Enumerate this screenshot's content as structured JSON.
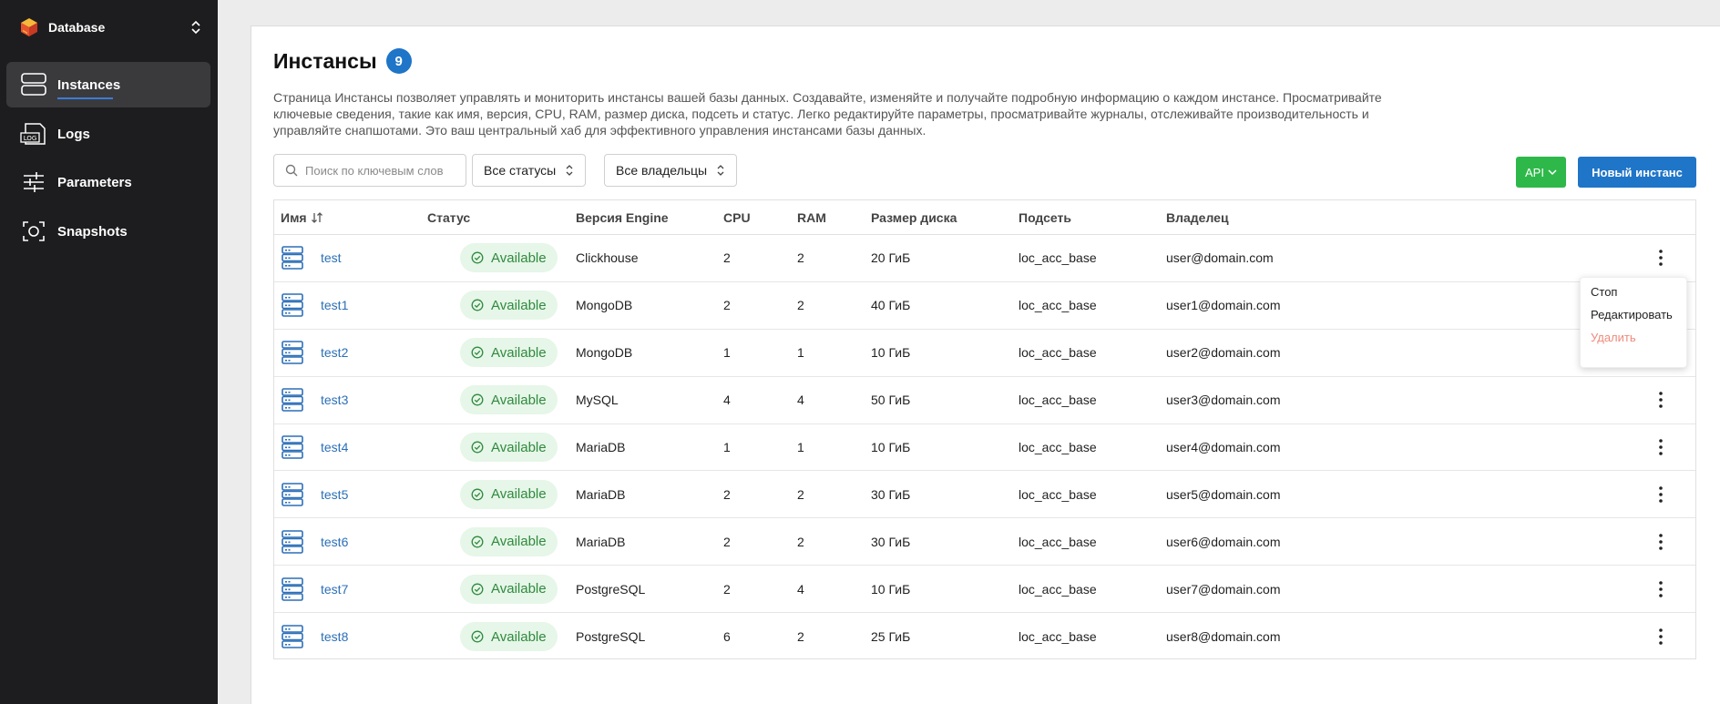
{
  "sidebar": {
    "brand": "Database",
    "items": [
      {
        "label": "Instances",
        "icon": "instances-icon"
      },
      {
        "label": "Logs",
        "icon": "logs-icon"
      },
      {
        "label": "Parameters",
        "icon": "sliders-icon"
      },
      {
        "label": "Snapshots",
        "icon": "snapshot-icon"
      }
    ],
    "logs_icon_text": "LOG"
  },
  "page": {
    "title": "Инстансы",
    "count": "9",
    "description": "Страница Инстансы позволяет управлять и мониторить инстансы вашей базы данных. Создавайте, изменяйте и получайте подробную информацию о каждом инстансе. Просматривайте ключевые сведения, такие как имя, версия, CPU, RAM, размер диска, подсеть и статус. Легко редактируйте параметры, просматривайте журналы, отслеживайте производительность и управляйте снапшотами. Это ваш центральный хаб для эффективного управления инстансами базы данных."
  },
  "toolbar": {
    "search_placeholder": "Поиск по ключевым слов",
    "status_filter": "Все статусы",
    "owner_filter": "Все владельцы",
    "api_label": "API",
    "new_label": "Новый инстанс"
  },
  "table": {
    "columns": [
      "Имя",
      "Статус",
      "Версия Engine",
      "CPU",
      "RAM",
      "Размер диска",
      "Подсеть",
      "Владелец"
    ],
    "rows": [
      {
        "name": "test",
        "status": "Available",
        "engine": "Clickhouse",
        "cpu": "2",
        "ram": "2",
        "disk": "20 ГиБ",
        "subnet": "loc_acc_base",
        "owner": "user@domain.com"
      },
      {
        "name": "test1",
        "status": "Available",
        "engine": "MongoDB",
        "cpu": "2",
        "ram": "2",
        "disk": "40 ГиБ",
        "subnet": "loc_acc_base",
        "owner": "user1@domain.com"
      },
      {
        "name": "test2",
        "status": "Available",
        "engine": "MongoDB",
        "cpu": "1",
        "ram": "1",
        "disk": "10 ГиБ",
        "subnet": "loc_acc_base",
        "owner": "user2@domain.com"
      },
      {
        "name": "test3",
        "status": "Available",
        "engine": "MySQL",
        "cpu": "4",
        "ram": "4",
        "disk": "50 ГиБ",
        "subnet": "loc_acc_base",
        "owner": "user3@domain.com"
      },
      {
        "name": "test4",
        "status": "Available",
        "engine": "MariaDB",
        "cpu": "1",
        "ram": "1",
        "disk": "10 ГиБ",
        "subnet": "loc_acc_base",
        "owner": "user4@domain.com"
      },
      {
        "name": "test5",
        "status": "Available",
        "engine": "MariaDB",
        "cpu": "2",
        "ram": "2",
        "disk": "30 ГиБ",
        "subnet": "loc_acc_base",
        "owner": "user5@domain.com"
      },
      {
        "name": "test6",
        "status": "Available",
        "engine": "MariaDB",
        "cpu": "2",
        "ram": "2",
        "disk": "30 ГиБ",
        "subnet": "loc_acc_base",
        "owner": "user6@domain.com"
      },
      {
        "name": "test7",
        "status": "Available",
        "engine": "PostgreSQL",
        "cpu": "2",
        "ram": "4",
        "disk": "10 ГиБ",
        "subnet": "loc_acc_base",
        "owner": "user7@domain.com"
      },
      {
        "name": "test8",
        "status": "Available",
        "engine": "PostgreSQL",
        "cpu": "6",
        "ram": "2",
        "disk": "25 ГиБ",
        "subnet": "loc_acc_base",
        "owner": "user8@domain.com"
      }
    ]
  },
  "menu": {
    "items": [
      "Стоп",
      "Редактировать",
      "Удалить"
    ]
  },
  "colors": {
    "accent": "#1f75c8",
    "api_green": "#2eb84a",
    "status_green": "#2f8a3e",
    "danger": "#f08a7c",
    "sidebar_bg": "#1d1d1f"
  }
}
